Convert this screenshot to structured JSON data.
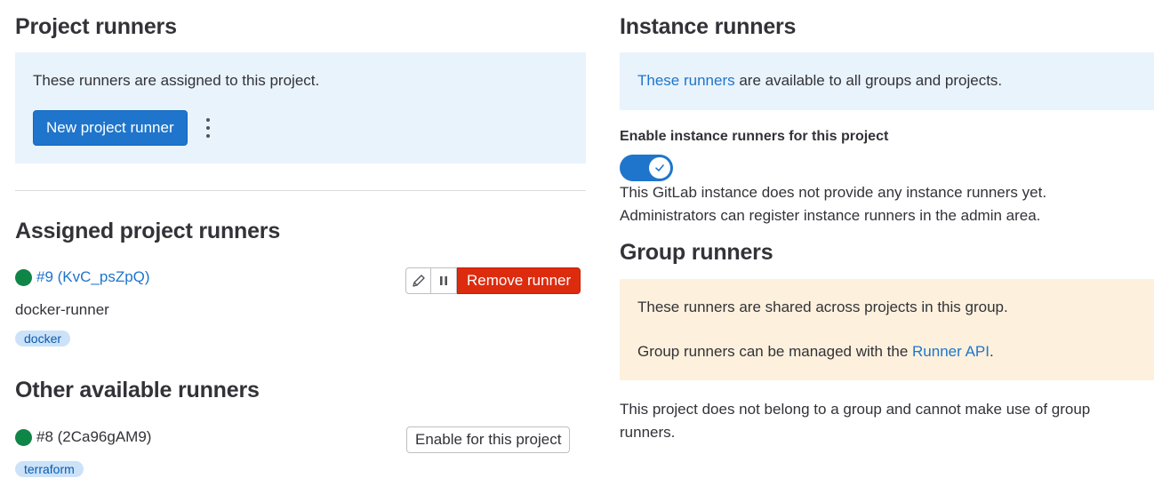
{
  "project_runners": {
    "title": "Project runners",
    "info": "These runners are assigned to this project.",
    "new_button": "New project runner"
  },
  "assigned": {
    "title": "Assigned project runners",
    "runner": {
      "id": "#9 (KvC_psZpQ)",
      "description": "docker-runner",
      "tag": "docker",
      "remove_label": "Remove runner",
      "status_color": "#108548"
    }
  },
  "other": {
    "title": "Other available runners",
    "runner": {
      "id": "#8 (2Ca96gAM9)",
      "tag": "terraform",
      "enable_label": "Enable for this project",
      "status_color": "#108548"
    }
  },
  "instance_runners": {
    "title": "Instance runners",
    "info_link": "These runners",
    "info_rest": " are available to all groups and projects.",
    "toggle_label": "Enable instance runners for this project",
    "toggle_on": true,
    "note_line1": "This GitLab instance does not provide any instance runners yet.",
    "note_line2": "Administrators can register instance runners in the admin area."
  },
  "group_runners": {
    "title": "Group runners",
    "info_line1": "These runners are shared across projects in this group.",
    "info_line2_prefix": "Group runners can be managed with the ",
    "info_line2_link": "Runner API",
    "info_line2_suffix": ".",
    "note": "This project does not belong to a group and cannot make use of group runners."
  },
  "colors": {
    "primary": "#1f75cb",
    "danger": "#dd2b0e",
    "success": "#108548",
    "info_bg": "#e9f3fc",
    "warning_bg": "#fdf1dd"
  }
}
